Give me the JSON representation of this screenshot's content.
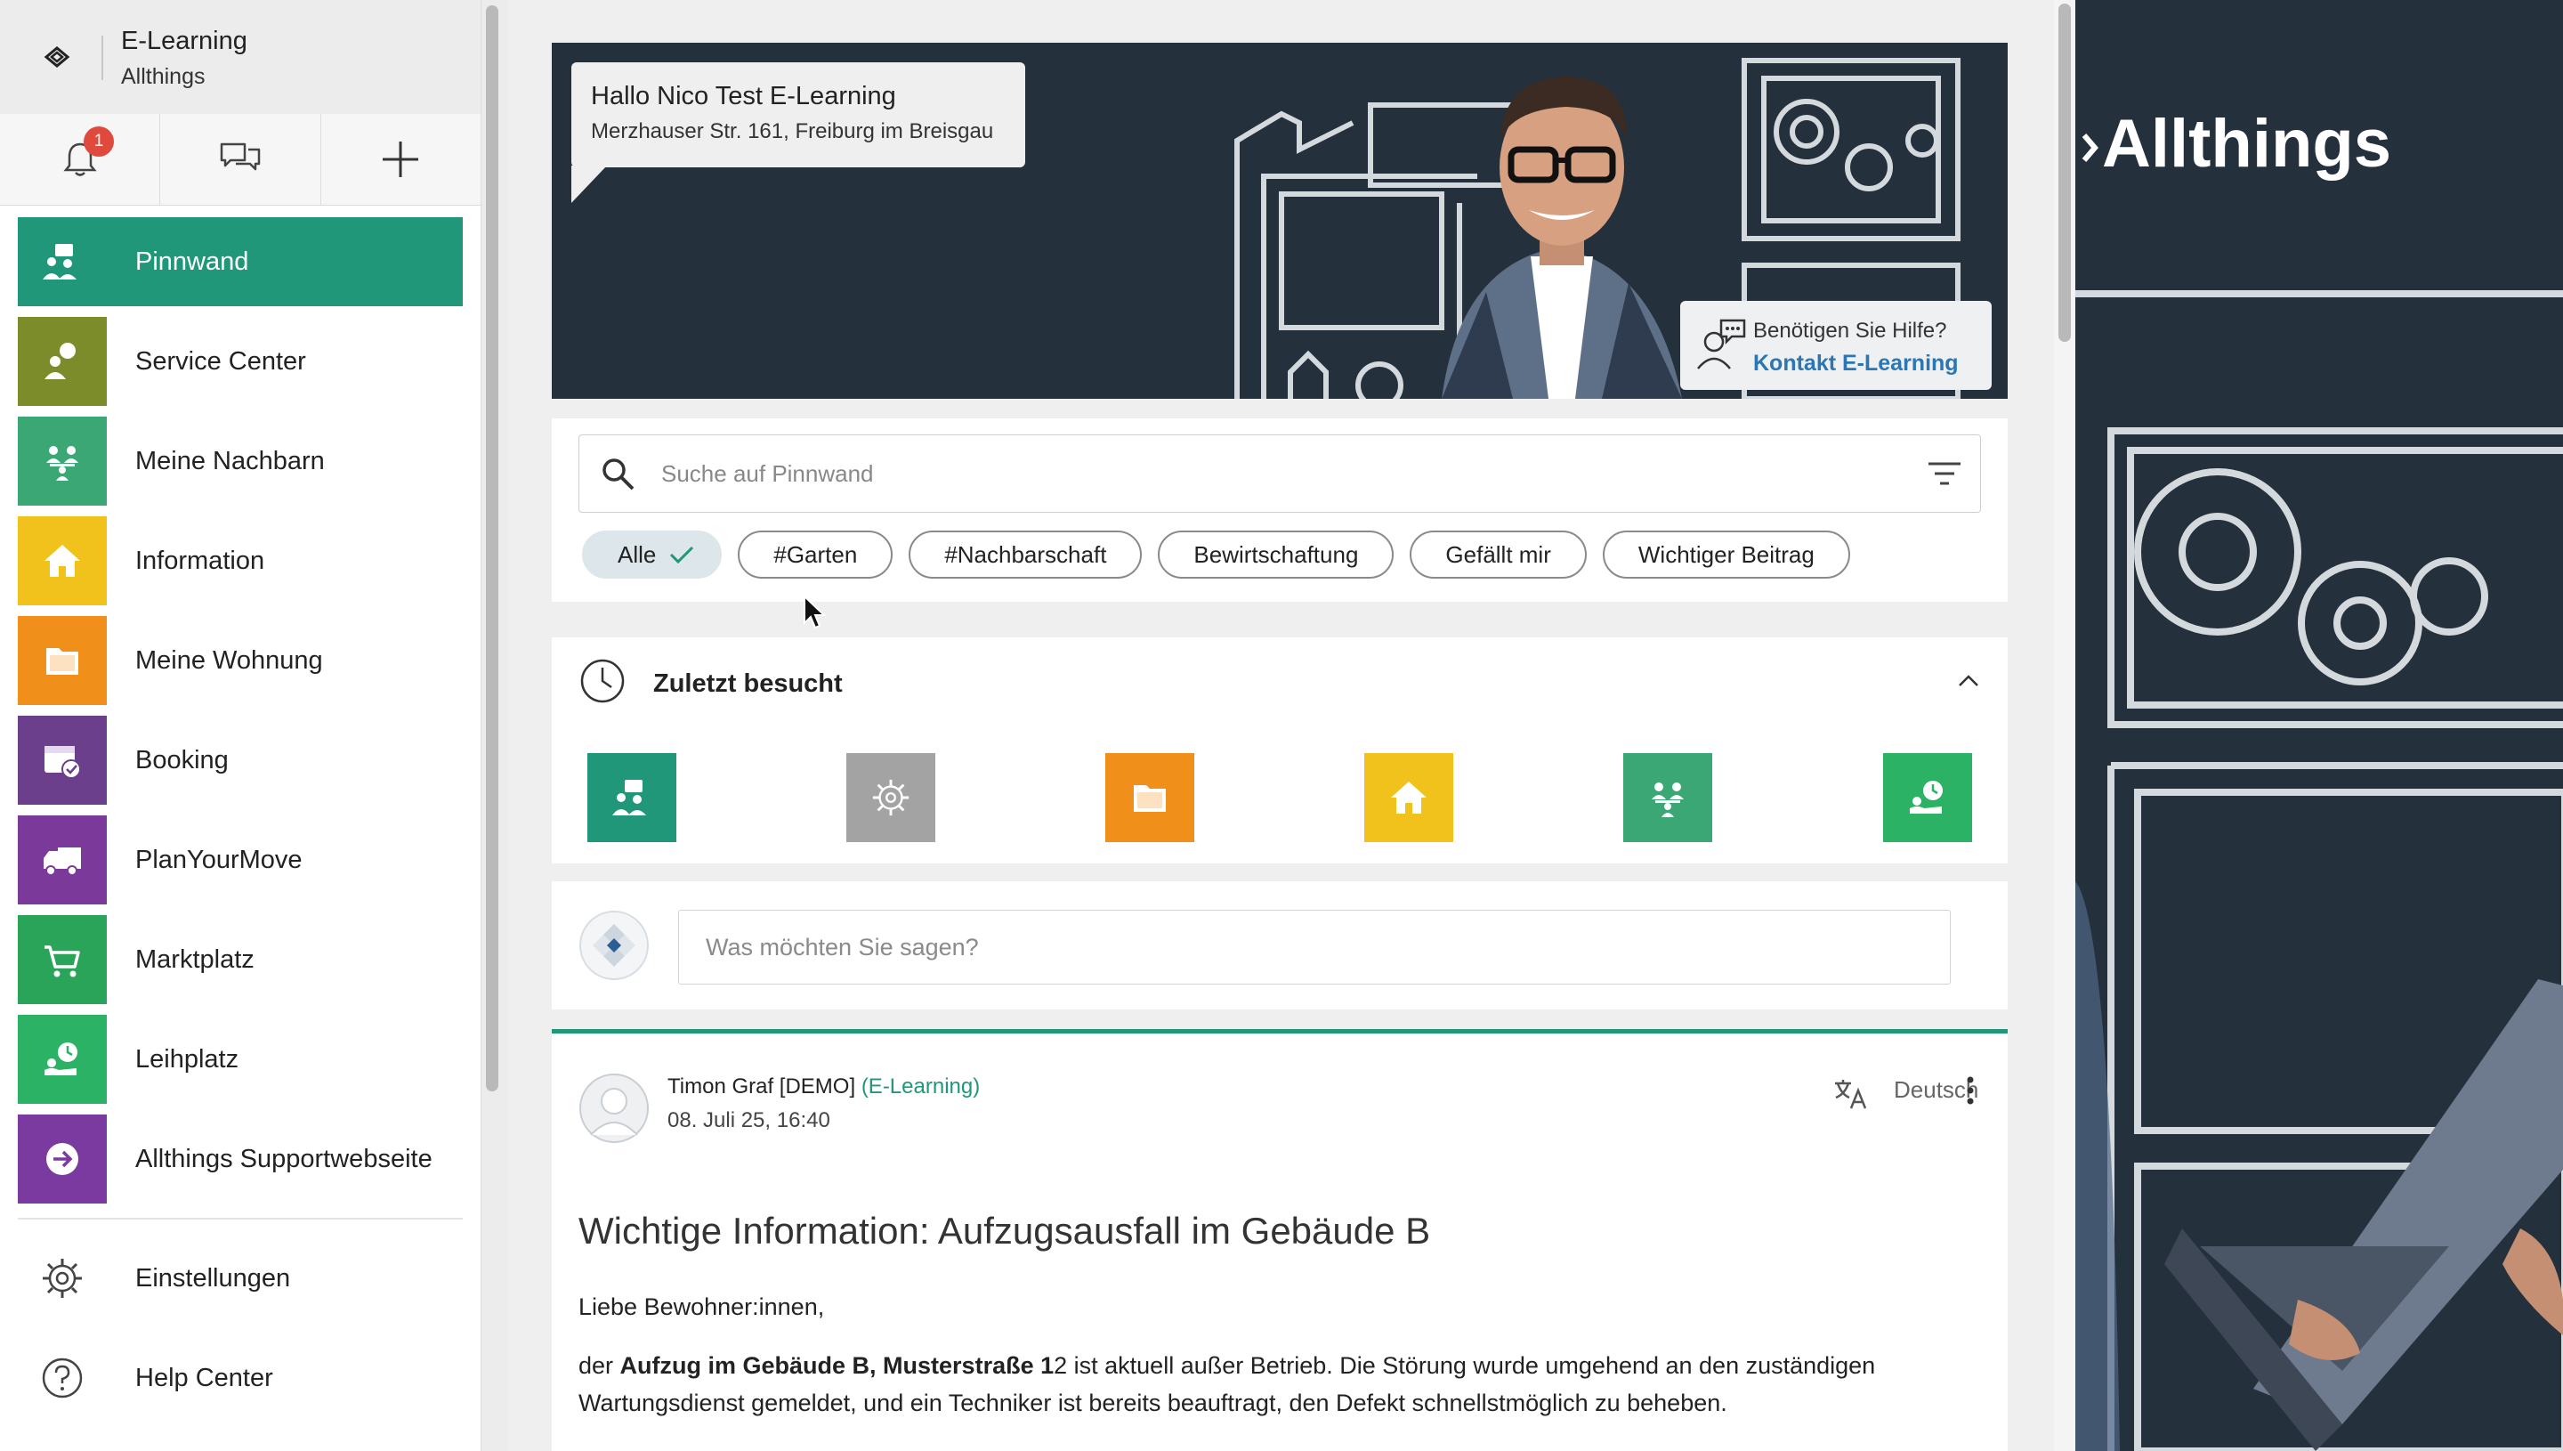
{
  "sidebar": {
    "app_title": "E-Learning",
    "app_subtitle": "Allthings",
    "notification_count": "1",
    "items": [
      {
        "label": "Pinnwand",
        "icon": "community-icon",
        "color": "#21977a"
      },
      {
        "label": "Service Center",
        "icon": "service-center-icon",
        "color": "#7c8c2a"
      },
      {
        "label": "Meine Nachbarn",
        "icon": "neighbors-icon",
        "color": "#3aa774"
      },
      {
        "label": "Information",
        "icon": "house-icon",
        "color": "#f0c21b"
      },
      {
        "label": "Meine Wohnung",
        "icon": "folder-icon",
        "color": "#f0901b"
      },
      {
        "label": "Booking",
        "icon": "calendar-icon",
        "color": "#6b3f8c"
      },
      {
        "label": "PlanYourMove",
        "icon": "truck-icon",
        "color": "#7b3a9a"
      },
      {
        "label": "Marktplatz",
        "icon": "cart-icon",
        "color": "#2aa458"
      },
      {
        "label": "Leihplatz",
        "icon": "lending-icon",
        "color": "#2bb265"
      },
      {
        "label": "Allthings Supportwebseite",
        "icon": "arrow-right-circle-icon",
        "color": "#7a3a9f"
      }
    ],
    "settings_label": "Einstellungen",
    "help_label": "Help Center"
  },
  "banner": {
    "greeting": "Hallo Nico Test E-Learning",
    "address": "Merzhauser Str. 161, Freiburg im Breisgau",
    "help_question": "Benötigen Sie Hilfe?",
    "help_link": "Kontakt E-Learning"
  },
  "search": {
    "placeholder": "Suche auf Pinnwand",
    "chips": [
      {
        "label": "Alle",
        "selected": true
      },
      {
        "label": "#Garten",
        "selected": false
      },
      {
        "label": "#Nachbarschaft",
        "selected": false
      },
      {
        "label": "Bewirtschaftung",
        "selected": false
      },
      {
        "label": "Gefällt mir",
        "selected": false
      },
      {
        "label": "Wichtiger Beitrag",
        "selected": false
      }
    ]
  },
  "recent": {
    "title": "Zuletzt besucht",
    "tiles": [
      {
        "icon": "community-icon",
        "color": "#21977a"
      },
      {
        "icon": "gear-icon",
        "color": "#a3a3a3"
      },
      {
        "icon": "folder-icon",
        "color": "#f0901b"
      },
      {
        "icon": "house-icon",
        "color": "#f0c21b"
      },
      {
        "icon": "neighbors-icon",
        "color": "#3aa774"
      },
      {
        "icon": "lending-icon",
        "color": "#2bb265"
      }
    ]
  },
  "composer": {
    "placeholder": "Was möchten Sie sagen?"
  },
  "post": {
    "author": "Timon Graf [DEMO]",
    "org": "(E-Learning)",
    "date": "08. Juli 25, 16:40",
    "language": "Deutsch",
    "headline": "Wichtige Information: Aufzugsausfall im Gebäude B",
    "greeting": "Liebe Bewohner:innen,",
    "body_prefix": "der ",
    "body_bold": "Aufzug im Gebäude B, Musterstraße 1",
    "body_rest": "2 ist aktuell außer Betrieb. Die Störung wurde umgehend an den zuständigen Wartungsdienst gemeldet, und ein Techniker ist bereits beauftragt, den Defekt schnellstmöglich zu beheben."
  },
  "brand": {
    "name": "Allthings"
  },
  "colors": {
    "accent": "#21977a",
    "banner_bg": "#25303d",
    "link": "#2b76b4",
    "badge": "#e04a3c"
  }
}
